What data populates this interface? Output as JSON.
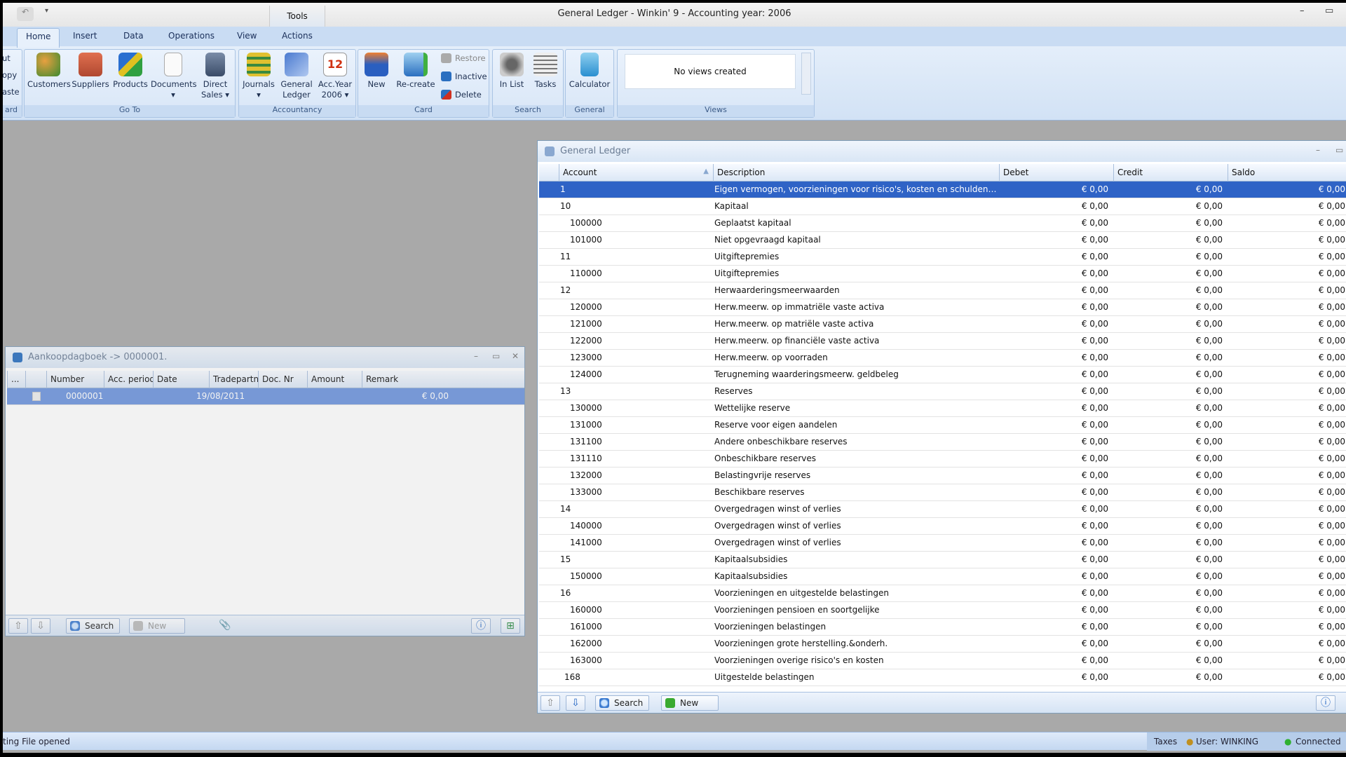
{
  "window": {
    "title": "General Ledger - Winkin' 9 - Accounting year: 2006",
    "context_tab_group": "Tools",
    "minimize": "–",
    "maximize": "▭"
  },
  "tabs": [
    {
      "label": "Home",
      "active": true
    },
    {
      "label": "Insert"
    },
    {
      "label": "Data"
    },
    {
      "label": "Operations"
    },
    {
      "label": "View"
    },
    {
      "label": "Actions"
    }
  ],
  "ribbon": {
    "clipboard": {
      "items": [
        "ut",
        "opy",
        "aste"
      ],
      "label": "ard"
    },
    "goto": {
      "label": "Go To",
      "buttons": [
        {
          "label": "Customers",
          "icon": "customers-icon"
        },
        {
          "label": "Suppliers",
          "icon": "factory-icon"
        },
        {
          "label": "Products",
          "icon": "products-icon"
        },
        {
          "label": "Documents",
          "icon": "document-icon",
          "dropdown": "▾"
        },
        {
          "label": "Direct",
          "label2": "Sales ▾",
          "icon": "cash-register-icon"
        }
      ]
    },
    "accountancy": {
      "label": "Accountancy",
      "buttons": [
        {
          "label": "Journals",
          "label2": "▾",
          "icon": "books-icon"
        },
        {
          "label": "General",
          "label2": "Ledger",
          "icon": "ledger-icon"
        },
        {
          "label": "Acc.Year",
          "label2": "2006 ▾",
          "icon": "calendar-icon",
          "calendar_day": "12"
        }
      ]
    },
    "card": {
      "label": "Card",
      "buttons": [
        {
          "label": "New",
          "icon": "new-card-icon"
        },
        {
          "label": "Re-create",
          "icon": "recreate-icon"
        }
      ],
      "small": [
        {
          "label": "Restore",
          "disabled": true
        },
        {
          "label": "Inactive"
        },
        {
          "label": "Delete"
        }
      ]
    },
    "search": {
      "label": "Search",
      "buttons": [
        {
          "label": "In List",
          "icon": "binoculars-icon"
        },
        {
          "label": "Tasks",
          "icon": "tasks-icon"
        }
      ]
    },
    "general": {
      "label": "General",
      "buttons": [
        {
          "label": "Calculator",
          "icon": "calculator-icon"
        }
      ]
    },
    "views": {
      "label": "Views",
      "empty_text": "No views created"
    }
  },
  "journal_window": {
    "title": "Aankoopdagboek -> 0000001.",
    "columns": [
      "...",
      "",
      "Number",
      "Acc. period",
      "Date",
      "Tradepartner",
      "Doc. Nr",
      "Amount",
      "Remark"
    ],
    "rows": [
      {
        "number": "0000001",
        "acc_period": "",
        "date": "19/08/2011",
        "tradepartner": "",
        "doc_nr": "",
        "amount": "€ 0,00",
        "remark": "",
        "selected": true
      }
    ],
    "footer": {
      "search": "Search",
      "new": "New"
    }
  },
  "ledger": {
    "title": "General Ledger",
    "columns": [
      "Account",
      "Description",
      "Debet",
      "Credit",
      "Saldo"
    ],
    "sorted_column": "Account",
    "rows": [
      {
        "account": "1",
        "description": "Eigen vermogen, voorzieningen voor risico's, kosten en schulden op m...",
        "debet": "€ 0,00",
        "credit": "€ 0,00",
        "saldo": "€ 0,00",
        "selected": true
      },
      {
        "account": "10",
        "description": "Kapitaal",
        "debet": "€ 0,00",
        "credit": "€ 0,00",
        "saldo": "€ 0,00"
      },
      {
        "account": "100000",
        "description": "Geplaatst kapitaal",
        "debet": "€ 0,00",
        "credit": "€ 0,00",
        "saldo": "€ 0,00"
      },
      {
        "account": "101000",
        "description": "Niet opgevraagd kapitaal",
        "debet": "€ 0,00",
        "credit": "€ 0,00",
        "saldo": "€ 0,00"
      },
      {
        "account": "11",
        "description": "Uitgiftepremies",
        "debet": "€ 0,00",
        "credit": "€ 0,00",
        "saldo": "€ 0,00"
      },
      {
        "account": "110000",
        "description": "Uitgiftepremies",
        "debet": "€ 0,00",
        "credit": "€ 0,00",
        "saldo": "€ 0,00"
      },
      {
        "account": "12",
        "description": "Herwaarderingsmeerwaarden",
        "debet": "€ 0,00",
        "credit": "€ 0,00",
        "saldo": "€ 0,00"
      },
      {
        "account": "120000",
        "description": "Herw.meerw. op immatriële vaste activa",
        "debet": "€ 0,00",
        "credit": "€ 0,00",
        "saldo": "€ 0,00"
      },
      {
        "account": "121000",
        "description": "Herw.meerw. op matriële vaste activa",
        "debet": "€ 0,00",
        "credit": "€ 0,00",
        "saldo": "€ 0,00"
      },
      {
        "account": "122000",
        "description": "Herw.meerw. op financiële vaste activa",
        "debet": "€ 0,00",
        "credit": "€ 0,00",
        "saldo": "€ 0,00"
      },
      {
        "account": "123000",
        "description": "Herw.meerw. op voorraden",
        "debet": "€ 0,00",
        "credit": "€ 0,00",
        "saldo": "€ 0,00"
      },
      {
        "account": "124000",
        "description": "Terugneming waarderingsmeerw. geldbeleg",
        "debet": "€ 0,00",
        "credit": "€ 0,00",
        "saldo": "€ 0,00"
      },
      {
        "account": "13",
        "description": "Reserves",
        "debet": "€ 0,00",
        "credit": "€ 0,00",
        "saldo": "€ 0,00"
      },
      {
        "account": "130000",
        "description": "Wettelijke reserve",
        "debet": "€ 0,00",
        "credit": "€ 0,00",
        "saldo": "€ 0,00"
      },
      {
        "account": "131000",
        "description": "Reserve voor eigen aandelen",
        "debet": "€ 0,00",
        "credit": "€ 0,00",
        "saldo": "€ 0,00"
      },
      {
        "account": "131100",
        "description": "Andere onbeschikbare reserves",
        "debet": "€ 0,00",
        "credit": "€ 0,00",
        "saldo": "€ 0,00"
      },
      {
        "account": "131110",
        "description": "Onbeschikbare reserves",
        "debet": "€ 0,00",
        "credit": "€ 0,00",
        "saldo": "€ 0,00"
      },
      {
        "account": "132000",
        "description": "Belastingvrije reserves",
        "debet": "€ 0,00",
        "credit": "€ 0,00",
        "saldo": "€ 0,00"
      },
      {
        "account": "133000",
        "description": "Beschikbare reserves",
        "debet": "€ 0,00",
        "credit": "€ 0,00",
        "saldo": "€ 0,00"
      },
      {
        "account": "14",
        "description": "Overgedragen winst of verlies",
        "debet": "€ 0,00",
        "credit": "€ 0,00",
        "saldo": "€ 0,00"
      },
      {
        "account": "140000",
        "description": "Overgedragen winst of verlies",
        "debet": "€ 0,00",
        "credit": "€ 0,00",
        "saldo": "€ 0,00"
      },
      {
        "account": "141000",
        "description": "Overgedragen winst of verlies",
        "debet": "€ 0,00",
        "credit": "€ 0,00",
        "saldo": "€ 0,00"
      },
      {
        "account": "15",
        "description": "Kapitaalsubsidies",
        "debet": "€ 0,00",
        "credit": "€ 0,00",
        "saldo": "€ 0,00"
      },
      {
        "account": "150000",
        "description": "Kapitaalsubsidies",
        "debet": "€ 0,00",
        "credit": "€ 0,00",
        "saldo": "€ 0,00"
      },
      {
        "account": "16",
        "description": "Voorzieningen en uitgestelde belastingen",
        "debet": "€ 0,00",
        "credit": "€ 0,00",
        "saldo": "€ 0,00"
      },
      {
        "account": "160000",
        "description": "Voorzieningen pensioen en soortgelijke",
        "debet": "€ 0,00",
        "credit": "€ 0,00",
        "saldo": "€ 0,00"
      },
      {
        "account": "161000",
        "description": "Voorzieningen belastingen",
        "debet": "€ 0,00",
        "credit": "€ 0,00",
        "saldo": "€ 0,00"
      },
      {
        "account": "162000",
        "description": "Voorzieningen grote herstelling.&onderh.",
        "debet": "€ 0,00",
        "credit": "€ 0,00",
        "saldo": "€ 0,00"
      },
      {
        "account": "163000",
        "description": "Voorzieningen overige risico's en kosten",
        "debet": "€ 0,00",
        "credit": "€ 0,00",
        "saldo": "€ 0,00"
      },
      {
        "account": "168",
        "description": "Uitgestelde belastingen",
        "debet": "€ 0,00",
        "credit": "€ 0,00",
        "saldo": "€ 0,00"
      }
    ],
    "footer": {
      "search": "Search",
      "new": "New"
    }
  },
  "statusbar": {
    "message": "ting File opened",
    "taxes": "Taxes",
    "user": "User: WINKING",
    "connection": "Connected"
  },
  "colors": {
    "selection": "#2f63c6",
    "ribbon": "#d2e2f5",
    "workspace": "#a9a9a9"
  }
}
